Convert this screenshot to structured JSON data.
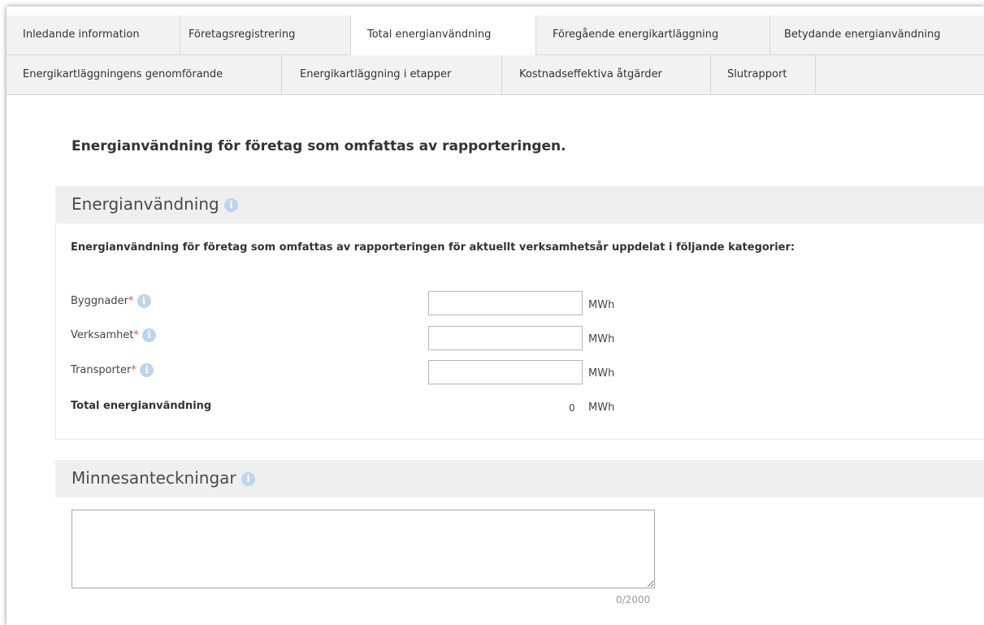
{
  "tabs_row1": [
    {
      "label": "Inledande information"
    },
    {
      "label": "Företagsregistrering"
    },
    {
      "label": "Total energianvändning"
    },
    {
      "label": "Föregående energikartläggning"
    },
    {
      "label": "Betydande energianvändning"
    }
  ],
  "tabs_row2": [
    {
      "label": "Energikartläggningens genomförande"
    },
    {
      "label": "Energikartläggning i etapper"
    },
    {
      "label": "Kostnadseffektiva åtgärder"
    },
    {
      "label": "Slutrapport"
    }
  ],
  "active_tab": "Total energianvändning",
  "page_heading": "Energianvändning för företag som omfattas av rapporteringen.",
  "energy_section": {
    "title": "Energianvändning",
    "info_icon": "info-icon",
    "description": "Energianvändning för företag som omfattas av rapporteringen för aktuellt verksamhetsår uppdelat i följande kategorier:",
    "rows": [
      {
        "label": "Byggnader",
        "required_mark": "*",
        "value": "",
        "unit": "MWh"
      },
      {
        "label": "Verksamhet",
        "required_mark": "*",
        "value": "",
        "unit": "MWh"
      },
      {
        "label": "Transporter",
        "required_mark": "*",
        "value": "",
        "unit": "MWh"
      }
    ],
    "total": {
      "label": "Total energianvändning",
      "value": "0",
      "unit": "MWh"
    }
  },
  "notes_section": {
    "title": "Minnesanteckningar",
    "info_icon": "info-icon",
    "value": "",
    "counter": "0/2000"
  },
  "colors": {
    "tab_background": "#f2f2f2",
    "section_header": "#efefef",
    "info_icon": "#bcd4ec",
    "required": "#d9534f"
  }
}
